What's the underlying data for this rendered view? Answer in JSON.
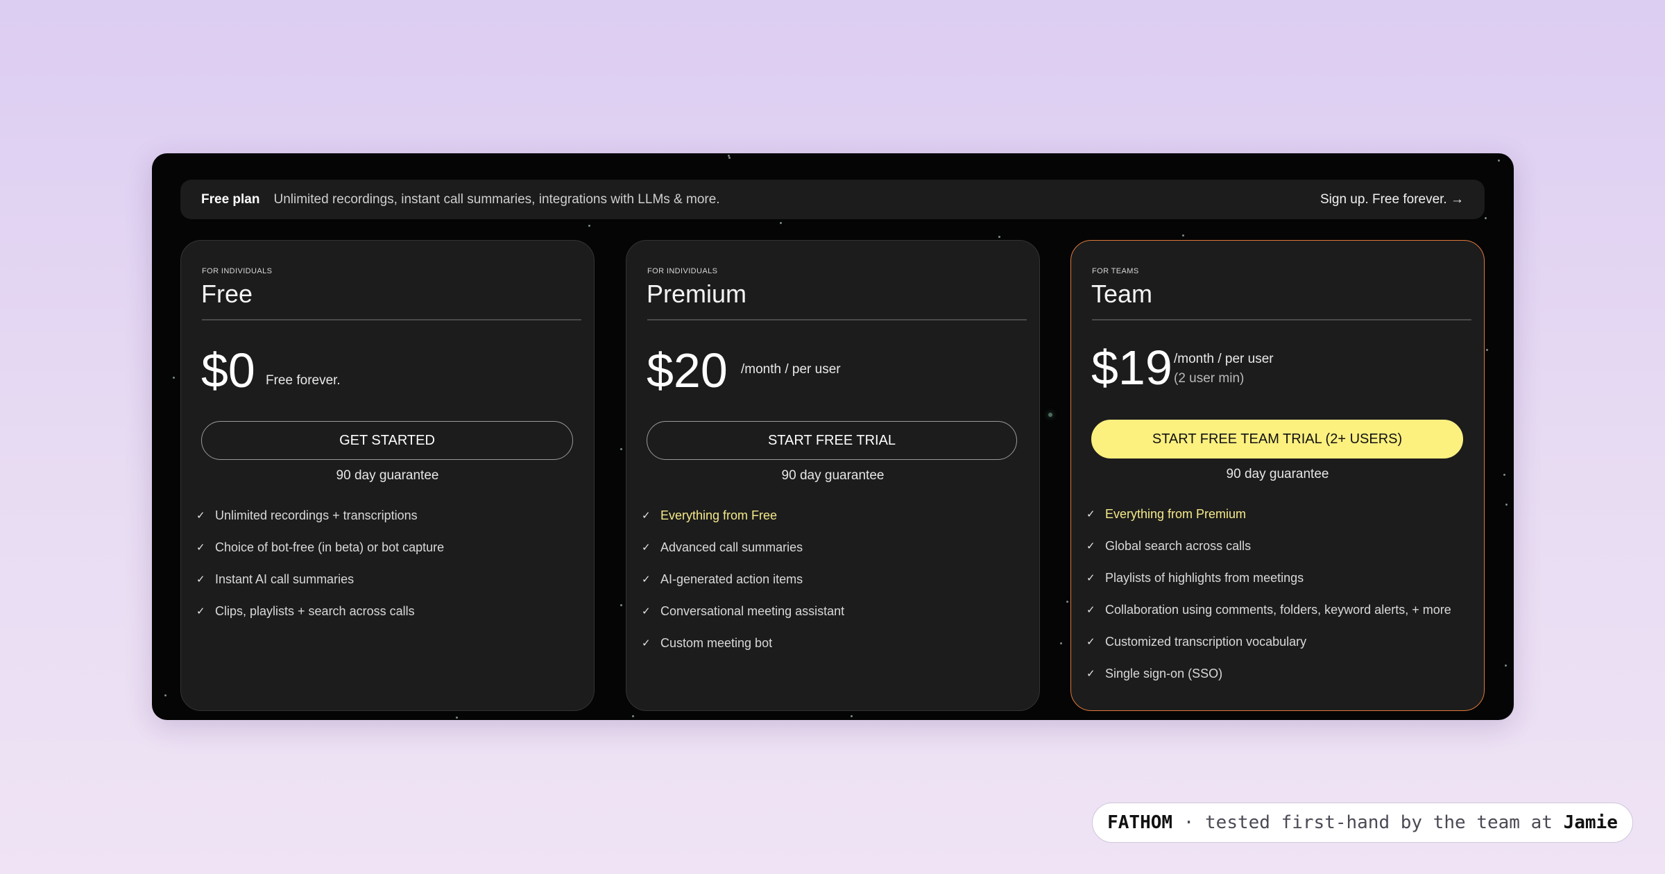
{
  "banner": {
    "title": "Free plan",
    "description": "Unlimited recordings, instant call summaries, integrations with LLMs & more.",
    "link": "Sign up. Free forever. →"
  },
  "plans": [
    {
      "audience": "FOR INDIVIDUALS",
      "name": "Free",
      "price": "$0",
      "price_note": "Free forever.",
      "price_sub": "",
      "cta": "GET STARTED",
      "guarantee": "90 day guarantee",
      "features": [
        "Unlimited recordings + transcriptions",
        "Choice of bot-free (in beta) or bot capture",
        "Instant AI call summaries",
        "Clips, playlists + search across calls"
      ]
    },
    {
      "audience": "FOR INDIVIDUALS",
      "name": "Premium",
      "price": "$20",
      "price_note": "/month / per user",
      "price_sub": "",
      "cta": "START FREE TRIAL",
      "guarantee": "90 day guarantee",
      "features": [
        "Everything from Free",
        "Advanced call summaries",
        "AI-generated action items",
        "Conversational meeting assistant",
        "Custom meeting bot"
      ]
    },
    {
      "audience": "FOR TEAMS",
      "name": "Team",
      "price": "$19",
      "price_note": "/month / per user",
      "price_sub": "(2 user min)",
      "cta": "START FREE TEAM TRIAL (2+ USERS)",
      "guarantee": "90 day guarantee",
      "features": [
        "Everything from Premium",
        "Global search across calls",
        "Playlists of highlights from meetings",
        "Collaboration using comments, folders, keyword alerts, + more",
        "Customized transcription vocabulary",
        "Single sign-on (SSO)"
      ]
    }
  ],
  "credit": {
    "brand": "FATHOM",
    "text": " · tested first-hand by the team at ",
    "team": "Jamie"
  },
  "colors": {
    "accent_yellow": "#fcf07f",
    "highlight_text": "#f5e98a",
    "team_border": "#e07a3c",
    "card_bg": "#1c1c1c",
    "panel_bg": "#050505"
  },
  "icons": {
    "feature_check": "check-icon"
  }
}
